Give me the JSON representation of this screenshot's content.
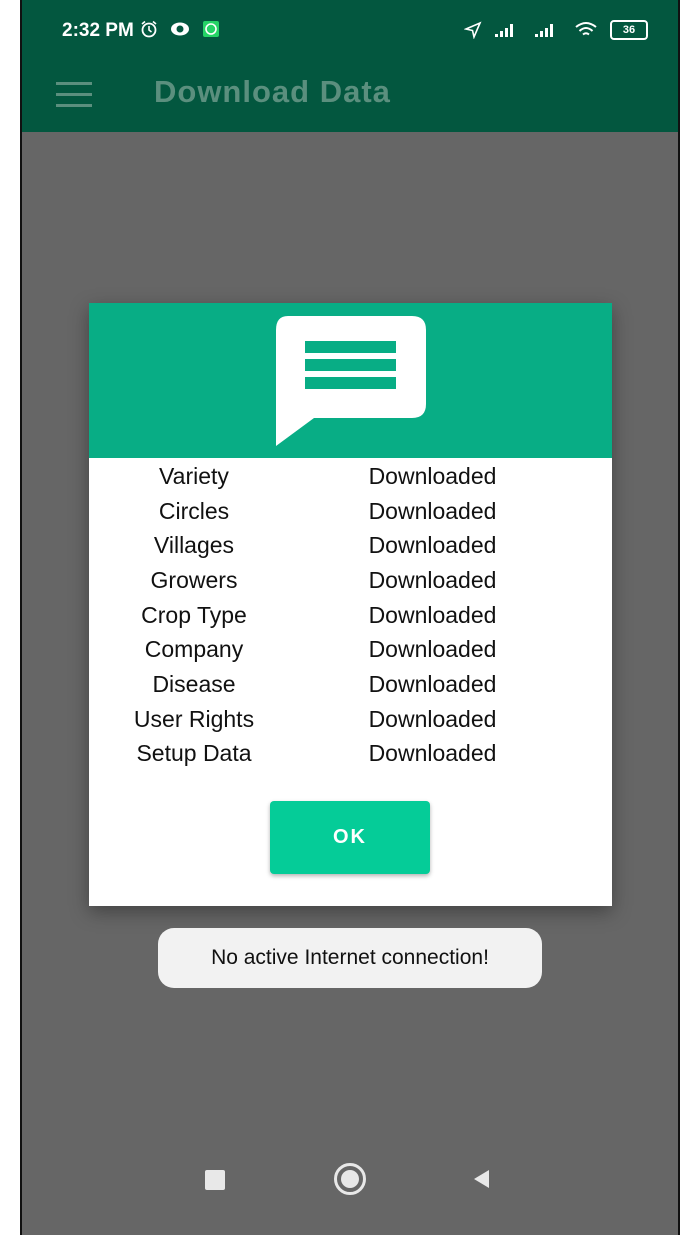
{
  "status_bar": {
    "time": "2:32 PM",
    "battery": "36"
  },
  "app_bar": {
    "title": "Download Data"
  },
  "dialog": {
    "rows": [
      {
        "name": "Variety",
        "status": "Downloaded"
      },
      {
        "name": "Circles",
        "status": "Downloaded"
      },
      {
        "name": "Villages",
        "status": "Downloaded"
      },
      {
        "name": "Growers",
        "status": "Downloaded"
      },
      {
        "name": "Crop Type",
        "status": "Downloaded"
      },
      {
        "name": "Company",
        "status": "Downloaded"
      },
      {
        "name": "Disease",
        "status": "Downloaded"
      },
      {
        "name": "User Rights",
        "status": "Downloaded"
      },
      {
        "name": "Setup Data",
        "status": "Downloaded"
      }
    ],
    "ok_label": "OK",
    "header_color": "#08ad85",
    "button_color": "#05cc98"
  },
  "toast": {
    "message": "No active Internet connection!"
  },
  "colors": {
    "appbar": "#03573f",
    "scrim": "#666666"
  },
  "icons": {
    "alarm": "alarm-icon",
    "eye": "eye-icon",
    "whatsapp": "whatsapp-icon",
    "location": "location-arrow-icon",
    "signal": "signal-icon",
    "wifi": "wifi-icon",
    "battery": "battery-icon",
    "menu": "hamburger-menu-icon",
    "message": "message-icon"
  }
}
